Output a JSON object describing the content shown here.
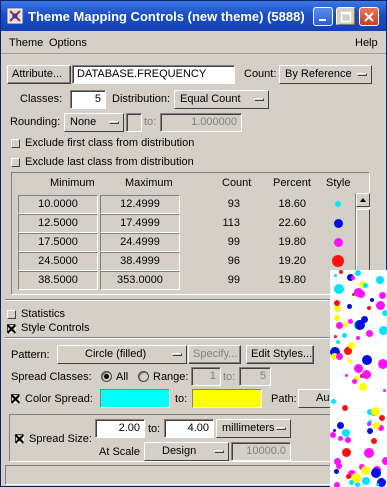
{
  "window": {
    "title": "Theme Mapping Controls (new theme) (5888)",
    "colors": {
      "titlebar": "#1c4fc2",
      "face": "#d4d0c8"
    }
  },
  "menu": {
    "theme": "Theme",
    "options": "Options",
    "help": "Help"
  },
  "attribute": {
    "button_label": "Attribute...",
    "value": "DATABASE.FREQUENCY",
    "count_label": "Count:",
    "count_value": "By Reference"
  },
  "classes": {
    "label": "Classes:",
    "value": "5",
    "distribution_label": "Distribution:",
    "distribution_value": "Equal Count"
  },
  "rounding": {
    "label": "Rounding:",
    "value": "None",
    "to_label": "to:",
    "to_value": "1.000000"
  },
  "exclude_first": {
    "label": "Exclude first class from distribution",
    "checked": false
  },
  "exclude_last": {
    "label": "Exclude last class from distribution",
    "checked": false
  },
  "table": {
    "headers": [
      "Minimum",
      "Maximum",
      "Count",
      "Percent",
      "Style"
    ],
    "rows": [
      {
        "min": "10.0000",
        "max": "12.4999",
        "count": "93",
        "percent": "18.60",
        "style_color": "#00e5ff",
        "style_size": "small"
      },
      {
        "min": "12.5000",
        "max": "17.4999",
        "count": "113",
        "percent": "22.60",
        "style_color": "#0010e0",
        "style_size": "medium"
      },
      {
        "min": "17.5000",
        "max": "24.4999",
        "count": "99",
        "percent": "19.80",
        "style_color": "#ff10ff",
        "style_size": "medium"
      },
      {
        "min": "24.5000",
        "max": "38.4999",
        "count": "96",
        "percent": "19.20",
        "style_color": "#ff1010",
        "style_size": "large"
      },
      {
        "min": "38.5000",
        "max": "353.0000",
        "count": "99",
        "percent": "19.80",
        "style_color": "#ffff00",
        "style_size": "large"
      }
    ]
  },
  "statistics": {
    "label": "Statistics",
    "checked": false
  },
  "style_controls": {
    "label": "Style Controls",
    "checked": true
  },
  "pattern": {
    "label": "Pattern:",
    "value": "Circle (filled)",
    "specify_label": "Specify...",
    "edit_styles_label": "Edit Styles..."
  },
  "spread_classes": {
    "label": "Spread Classes:",
    "all_label": "All",
    "range_label": "Range:",
    "range_from": "1",
    "to_label": "to:",
    "range_to": "5",
    "selected": "All"
  },
  "color_spread": {
    "label": "Color Spread:",
    "checked": true,
    "from_color": "#00ffff",
    "to_label": "to:",
    "to_color": "#ffff00",
    "path_label": "Path:",
    "path_value": "Auto"
  },
  "spread_size": {
    "label": "Spread Size:",
    "checked": true,
    "from": "2.00",
    "to_label": "to:",
    "to": "4.00",
    "units": "millimeters",
    "at_scale_label": "At Scale",
    "scale_mode": "Design",
    "scale_value": "10000.0"
  }
}
